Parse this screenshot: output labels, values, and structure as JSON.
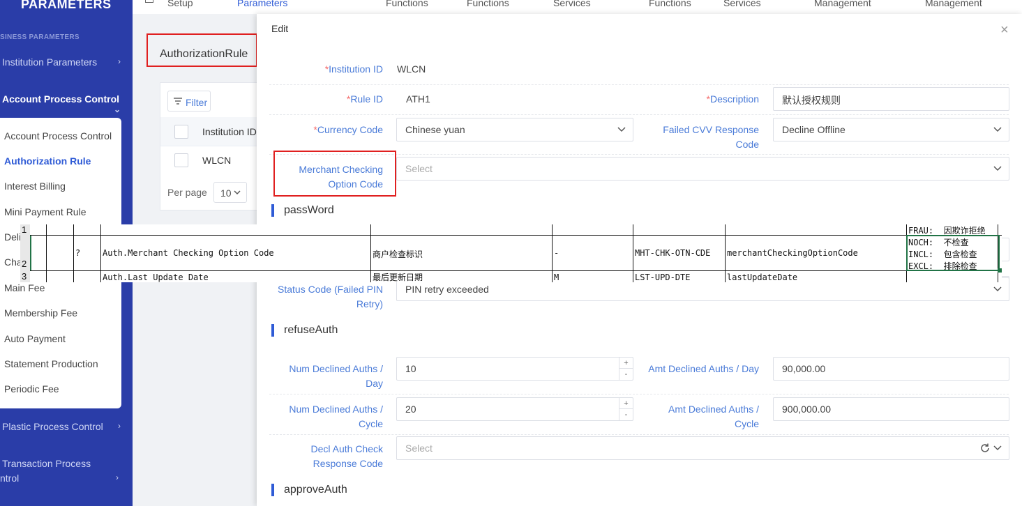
{
  "sidebar": {
    "brand": "PARAMETERS",
    "section_caption": "SINESS PARAMETERS",
    "items": [
      {
        "label": "Institution Parameters"
      },
      {
        "label": "Account Process Control"
      },
      {
        "label": "Plastic Process Control"
      },
      {
        "label": "Transaction Process"
      },
      {
        "label": "ntrol"
      }
    ],
    "submenu": [
      {
        "label": "Account Process Control"
      },
      {
        "label": "Authorization Rule"
      },
      {
        "label": "Interest Billing"
      },
      {
        "label": "Mini Payment Rule"
      },
      {
        "label": "Deli"
      },
      {
        "label": "Cha"
      },
      {
        "label": "Main Fee"
      },
      {
        "label": "Membership Fee"
      },
      {
        "label": "Auto Payment"
      },
      {
        "label": "Statement Production"
      },
      {
        "label": "Periodic Fee"
      }
    ]
  },
  "topnav": {
    "items": [
      {
        "label": "Setup"
      },
      {
        "label": "Parameters"
      },
      {
        "label": "Functions"
      },
      {
        "label": "Functions"
      },
      {
        "label": "Services"
      },
      {
        "label": "Functions"
      },
      {
        "label": "Services"
      },
      {
        "label": "Management"
      },
      {
        "label": "Management"
      }
    ]
  },
  "background": {
    "page_title": "AuthorizationRule",
    "filter_label": "Filter",
    "column_header": "Institution ID",
    "row_value": "WLCN",
    "per_page_label": "Per page",
    "per_page_value": "10"
  },
  "dialog": {
    "title": "Edit",
    "close": "×",
    "required_mark": "*",
    "fields": {
      "institution_id": {
        "label": "Institution ID",
        "value": "WLCN"
      },
      "rule_id": {
        "label": "Rule ID",
        "value": "ATH1"
      },
      "description": {
        "label": "Description",
        "value": "默认授权规则"
      },
      "currency_code": {
        "label": "Currency Code",
        "value": "Chinese yuan"
      },
      "failed_cvv": {
        "label_1": "Failed CVV Response",
        "label_2": "Code",
        "value": "Decline Offline"
      },
      "merchant_checking": {
        "label_1": "Merchant Checking",
        "label_2": "Option Code",
        "placeholder": "Select"
      },
      "status_code_pin": {
        "label_1": "Status Code (Failed PIN",
        "label_2": "Retry)",
        "value": "PIN retry exceeded"
      },
      "num_declined_day": {
        "label_1": "Num Declined Auths /",
        "label_2": "Day",
        "value": "10"
      },
      "amt_declined_day": {
        "label": "Amt Declined Auths / Day",
        "value": "90,000.00"
      },
      "num_declined_cycle": {
        "label_1": "Num Declined Auths /",
        "label_2": "Cycle",
        "value": "20"
      },
      "amt_declined_cycle": {
        "label_1": "Amt Declined Auths /",
        "label_2": "Cycle",
        "value": "900,000.00"
      },
      "decl_auth_check": {
        "label_1": "Decl Auth Check",
        "label_2": "Response Code",
        "placeholder": "Select"
      }
    },
    "sections": {
      "password": "passWord",
      "refuse_auth": "refuseAuth",
      "approve_auth": "approveAuth"
    },
    "stepper": {
      "plus": "+",
      "minus": "-"
    }
  },
  "sheet": {
    "row_numbers": [
      "1",
      "2",
      "3"
    ],
    "rows": [
      {
        "flag": "?",
        "field": "Auth.Merchant Checking Option Code",
        "cn": "商户检查标识",
        "m": "-",
        "code": "MHT-CHK-OTN-CDE",
        "name": "merchantCheckingOptionCode"
      },
      {
        "flag": "",
        "field": "Auth.Last Update Date",
        "cn": "最后更新日期",
        "m": "M",
        "code": "LST-UPD-DTE",
        "name": "lastUpdateDate"
      }
    ],
    "options": [
      {
        "code": "FRAU:",
        "desc": "因欺诈拒绝"
      },
      {
        "code": "NOCH:",
        "desc": "不检查"
      },
      {
        "code": "INCL:",
        "desc": "包含检查"
      },
      {
        "code": "EXCL:",
        "desc": "排除检查"
      }
    ]
  }
}
